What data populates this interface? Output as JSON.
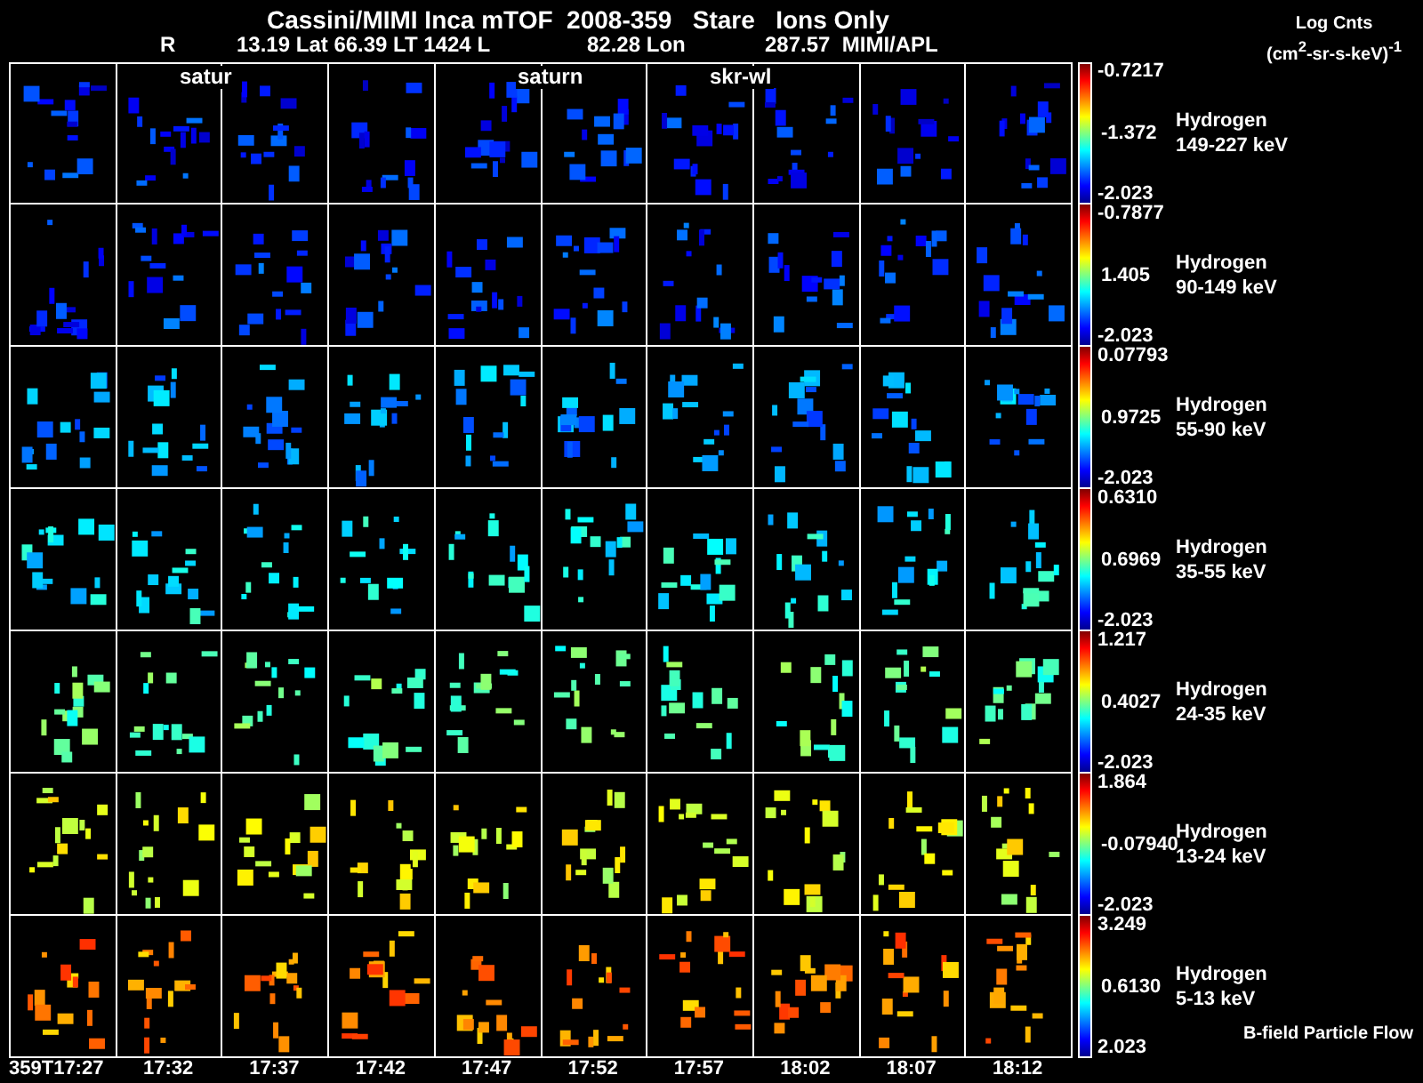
{
  "title": "Cassini/MIMI Inca mTOF  2008-359   Stare   Ions Only",
  "position": [
    "R",
    "13.19 Lat 66.39 LT 1424 L",
    "82.28 Lon",
    "287.57  MIMI/APL"
  ],
  "units": {
    "label": "Log Cnts",
    "unit": "(cm$^{2}$-sr-s-keV)$^{-1}$"
  },
  "overlay_labels": [
    "satur",
    "saturn",
    "skr-wl"
  ],
  "rows": [
    {
      "species": "Hydrogen",
      "energy": "149-227 keV",
      "max": "-0.7217",
      "mid": "-1.372",
      "min": "-2.023"
    },
    {
      "species": "Hydrogen",
      "energy": "90-149 keV",
      "max": "-0.7877",
      "mid": "1.405",
      "min": "-2.023"
    },
    {
      "species": "Hydrogen",
      "energy": "55-90 keV",
      "max": "0.07793",
      "mid": "0.9725",
      "min": "-2.023"
    },
    {
      "species": "Hydrogen",
      "energy": "35-55 keV",
      "max": "0.6310",
      "mid": "0.6969",
      "min": "-2.023"
    },
    {
      "species": "Hydrogen",
      "energy": "24-35 keV",
      "max": "1.217",
      "mid": "0.4027",
      "min": "-2.023"
    },
    {
      "species": "Hydrogen",
      "energy": "13-24 keV",
      "max": "1.864",
      "mid": "-0.07940",
      "min": "-2.023"
    },
    {
      "species": "Hydrogen",
      "energy": "5-13 keV",
      "max": "3.249",
      "mid": "0.6130",
      "min": "2.023"
    }
  ],
  "footnote": "B-field Particle Flow",
  "times": [
    "359T17:27",
    "17:32",
    "17:37",
    "17:42",
    "17:47",
    "17:52",
    "17:57",
    "18:02",
    "18:07",
    "18:12"
  ]
}
